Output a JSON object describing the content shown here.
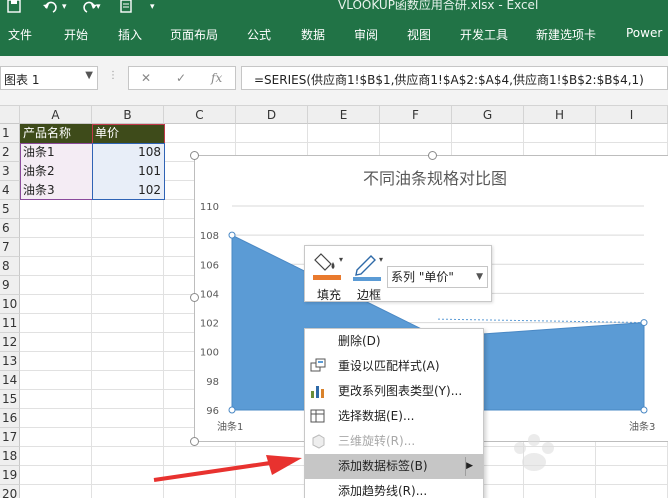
{
  "window": {
    "title": "VLOOKUP函数应用合研.xlsx - Excel",
    "brand_color": "#217346"
  },
  "quick_access": {
    "save_icon": "save-icon",
    "undo_icon": "undo-icon",
    "redo_icon": "redo-icon",
    "print_icon": "print-preview-icon",
    "customize_icon": "customize-toolbar-icon"
  },
  "ribbon": {
    "tabs": [
      "文件",
      "开始",
      "插入",
      "页面布局",
      "公式",
      "数据",
      "审阅",
      "视图",
      "开发工具",
      "新建选项卡",
      "Power"
    ]
  },
  "formula_bar": {
    "name_box": "图表 1",
    "cancel": "✕",
    "enter": "✓",
    "fx": "fx",
    "formula": "=SERIES(供应商1!$B$1,供应商1!$A$2:$A$4,供应商1!$B$2:$B$4,1)"
  },
  "sheet": {
    "columns": [
      "A",
      "B",
      "C",
      "D",
      "E",
      "F",
      "G",
      "H",
      "I"
    ],
    "rows": [
      "1",
      "2",
      "3",
      "4",
      "5",
      "6",
      "7",
      "8",
      "9",
      "10",
      "11",
      "12",
      "13",
      "14",
      "15",
      "16",
      "17",
      "18",
      "19",
      "20"
    ],
    "header_fill": "#3e4b1a",
    "cells": {
      "A1": "产品名称",
      "B1": "单价",
      "A2": "油条1",
      "B2": "108",
      "A3": "油条2",
      "B3": "101",
      "A4": "油条3",
      "B4": "102"
    }
  },
  "chart_data": {
    "type": "area",
    "title": "不同油条规格对比图",
    "categories": [
      "油条1",
      "油条2",
      "油条3"
    ],
    "series": [
      {
        "name": "单价",
        "values": [
          108,
          101,
          102
        ],
        "color": "#5b9bd5"
      }
    ],
    "ylim": [
      96,
      110
    ],
    "yticks": [
      "110",
      "108",
      "106",
      "104",
      "102",
      "100",
      "98",
      "96"
    ],
    "grid": true,
    "xtick_labels": [
      "油条1",
      "油条3"
    ]
  },
  "mini_toolbar": {
    "fill_label": "填充",
    "border_label": "边框",
    "series_select": "系列 \"单价\""
  },
  "context_menu": {
    "items": [
      {
        "label": "删除(D)",
        "icon": "none",
        "enabled": true
      },
      {
        "label": "重设以匹配样式(A)",
        "icon": "reset-style-icon",
        "enabled": true
      },
      {
        "label": "更改系列图表类型(Y)...",
        "icon": "change-chart-type-icon",
        "enabled": true
      },
      {
        "label": "选择数据(E)...",
        "icon": "select-data-icon",
        "enabled": true
      },
      {
        "label": "三维旋转(R)...",
        "icon": "3d-rotation-icon",
        "enabled": false
      },
      {
        "label": "添加数据标签(B)",
        "icon": "none",
        "enabled": true,
        "highlighted": true,
        "submenu": true
      },
      {
        "label": "添加趋势线(R)...",
        "icon": "none",
        "enabled": true
      }
    ]
  },
  "annotation": {
    "arrow_color": "#e8322f"
  }
}
